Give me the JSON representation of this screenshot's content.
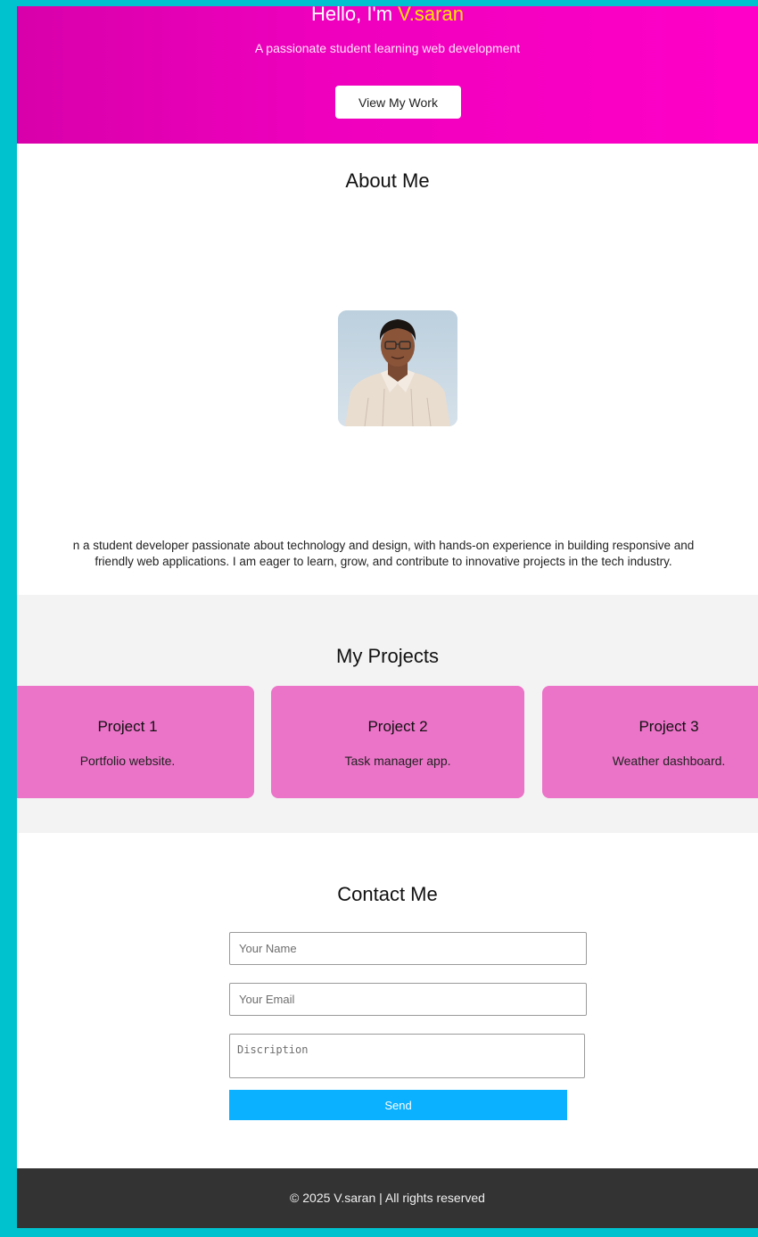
{
  "hero": {
    "greeting": "Hello, I'm ",
    "name": "V.saran",
    "tagline": "A passionate student learning web development",
    "cta_label": "View My Work"
  },
  "about": {
    "title": "About Me",
    "line1": "n a student developer passionate about technology and design, with hands-on experience in building responsive and",
    "line2": "friendly web applications. I am eager to learn, grow, and contribute to innovative projects in the tech industry."
  },
  "projects": {
    "title": "My Projects",
    "items": [
      {
        "title": "Project 1",
        "description": "Portfolio website."
      },
      {
        "title": "Project 2",
        "description": "Task manager app."
      },
      {
        "title": "Project 3",
        "description": "Weather dashboard."
      }
    ]
  },
  "contact": {
    "title": "Contact Me",
    "name_placeholder": "Your Name",
    "email_placeholder": "Your Email",
    "description_placeholder": "Discription",
    "send_label": "Send"
  },
  "footer": {
    "text": "© 2025 V.saran | All rights reserved"
  },
  "colors": {
    "background_accent": "#00c2cf",
    "hero": "#ff00c8",
    "highlight": "#ffe600",
    "card": "#eb73c8",
    "send_button": "#0bb0ff",
    "footer": "#333333"
  }
}
